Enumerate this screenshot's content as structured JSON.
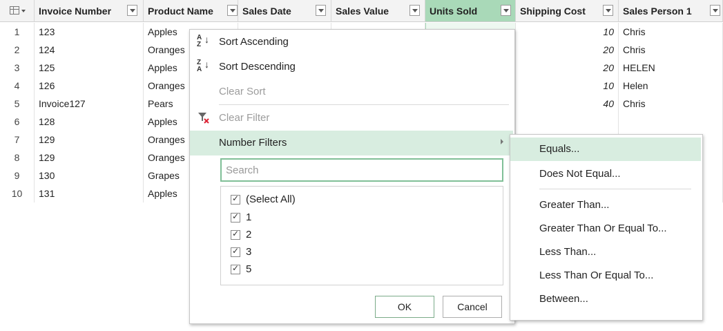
{
  "table": {
    "columns": [
      "Invoice Number",
      "Product Name",
      "Sales Date",
      "Sales Value",
      "Units Sold",
      "Shipping Cost",
      "Sales Person 1"
    ],
    "rows": [
      {
        "n": "1",
        "invoice": "123",
        "product": "Apples",
        "shipping": "10",
        "person": "Chris"
      },
      {
        "n": "2",
        "invoice": "124",
        "product": "Oranges",
        "shipping": "20",
        "person": "Chris"
      },
      {
        "n": "3",
        "invoice": "125",
        "product": "Apples",
        "shipping": "20",
        "person": "HELEN"
      },
      {
        "n": "4",
        "invoice": "126",
        "product": "Oranges",
        "shipping": "10",
        "person": "Helen"
      },
      {
        "n": "5",
        "invoice": "Invoice127",
        "product": "Pears",
        "shipping": "40",
        "person": "Chris"
      },
      {
        "n": "6",
        "invoice": "128",
        "product": "Apples",
        "shipping": "",
        "person": ""
      },
      {
        "n": "7",
        "invoice": "129",
        "product": "Oranges",
        "shipping": "",
        "person": ""
      },
      {
        "n": "8",
        "invoice": "129",
        "product": "Oranges",
        "shipping": "",
        "person": ""
      },
      {
        "n": "9",
        "invoice": "130",
        "product": "Grapes",
        "shipping": "",
        "person": ""
      },
      {
        "n": "10",
        "invoice": "131",
        "product": "Apples",
        "shipping": "",
        "person": ""
      }
    ]
  },
  "menu": {
    "sort_asc": "Sort Ascending",
    "sort_desc": "Sort Descending",
    "clear_sort": "Clear Sort",
    "clear_filter": "Clear Filter",
    "number_filters": "Number Filters",
    "search_placeholder": "Search",
    "values": [
      "(Select All)",
      "1",
      "2",
      "3",
      "5"
    ],
    "ok": "OK",
    "cancel": "Cancel",
    "icons": {
      "sort_asc": "sort-ascending-icon",
      "sort_desc": "sort-descending-icon",
      "clear_filter": "clear-filter-icon"
    }
  },
  "submenu": {
    "items": [
      "Equals...",
      "Does Not Equal...",
      "Greater Than...",
      "Greater Than Or Equal To...",
      "Less Than...",
      "Less Than Or Equal To...",
      "Between..."
    ]
  },
  "colors": {
    "selected_header": "#a9d9b8",
    "highlight": "#d8ede0",
    "accent_border": "#80bf97"
  }
}
